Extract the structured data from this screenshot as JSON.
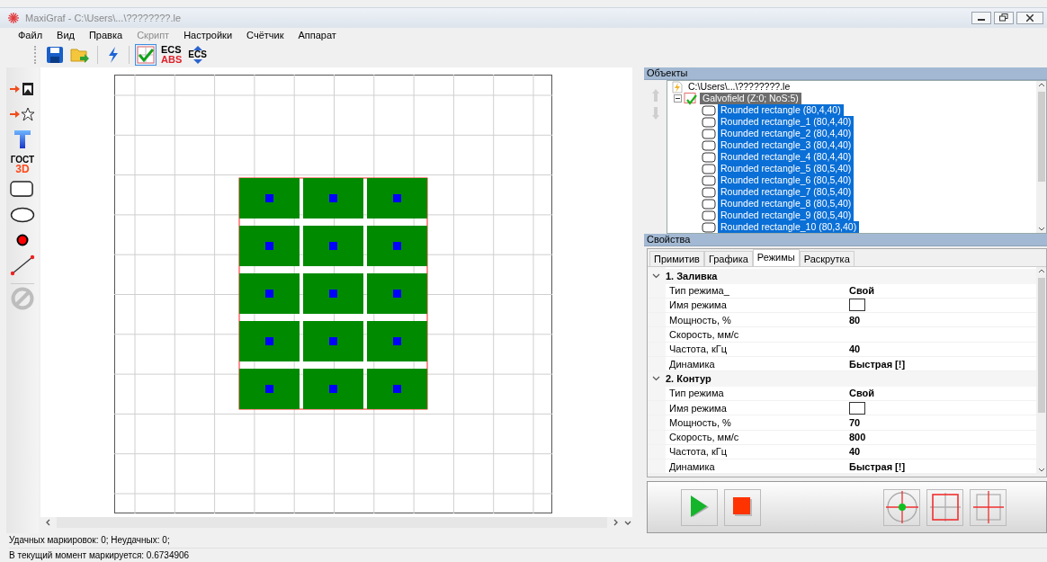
{
  "window": {
    "title": "MaxiGraf - C:\\Users\\...\\????????.le"
  },
  "menu": [
    {
      "label": "Файл",
      "disabled": false
    },
    {
      "label": "Вид",
      "disabled": false
    },
    {
      "label": "Правка",
      "disabled": false
    },
    {
      "label": "Скрипт",
      "disabled": true
    },
    {
      "label": "Настройки",
      "disabled": false
    },
    {
      "label": "Счётчик",
      "disabled": false
    },
    {
      "label": "Аппарат",
      "disabled": false
    }
  ],
  "toolbar": [
    {
      "kind": "save",
      "selected": false
    },
    {
      "kind": "open",
      "selected": false
    },
    {
      "kind": "flash",
      "selected": false
    },
    {
      "kind": "check-grid",
      "selected": true
    },
    {
      "kind": "ecs-abs",
      "selected": false,
      "texts": [
        "ECS",
        "ABS"
      ]
    },
    {
      "kind": "ecs-arrows",
      "selected": false,
      "texts": [
        "ECS"
      ]
    }
  ],
  "toolbox": [
    {
      "kind": "place-image"
    },
    {
      "kind": "place-star"
    },
    {
      "kind": "text-tool"
    },
    {
      "kind": "gost",
      "texts": [
        "ГОСТ",
        "3D"
      ]
    },
    {
      "kind": "rounded-rect"
    },
    {
      "kind": "ellipse"
    },
    {
      "kind": "point"
    },
    {
      "kind": "line"
    },
    {
      "kind": "forbid"
    }
  ],
  "objects": {
    "title": "Объекты",
    "tree": [
      {
        "kind": "file",
        "label": "C:\\Users\\...\\????????.le",
        "children": [
          {
            "kind": "group",
            "label": "Galvofield (Z:0; NoS:5)",
            "selected": true,
            "expanded": true,
            "children": [
              {
                "kind": "shape",
                "label": "Rounded rectangle (80,4,40)",
                "selected": true
              },
              {
                "kind": "shape",
                "label": "Rounded rectangle_1 (80,4,40)",
                "selected": true
              },
              {
                "kind": "shape",
                "label": "Rounded rectangle_2 (80,4,40)",
                "selected": true
              },
              {
                "kind": "shape",
                "label": "Rounded rectangle_3 (80,4,40)",
                "selected": true
              },
              {
                "kind": "shape",
                "label": "Rounded rectangle_4 (80,4,40)",
                "selected": true
              },
              {
                "kind": "shape",
                "label": "Rounded rectangle_5 (80,5,40)",
                "selected": true
              },
              {
                "kind": "shape",
                "label": "Rounded rectangle_6 (80,5,40)",
                "selected": true
              },
              {
                "kind": "shape",
                "label": "Rounded rectangle_7 (80,5,40)",
                "selected": true
              },
              {
                "kind": "shape",
                "label": "Rounded rectangle_8 (80,5,40)",
                "selected": true
              },
              {
                "kind": "shape",
                "label": "Rounded rectangle_9 (80,5,40)",
                "selected": true
              },
              {
                "kind": "shape",
                "label": "Rounded rectangle_10 (80,3,40)",
                "selected": true
              }
            ]
          }
        ]
      }
    ]
  },
  "properties": {
    "title": "Свойства",
    "tabs": [
      {
        "label": "Примитив",
        "selected": false
      },
      {
        "label": "Графика",
        "selected": false
      },
      {
        "label": "Режимы",
        "selected": true
      },
      {
        "label": "Раскрутка",
        "selected": false
      }
    ],
    "groups": [
      {
        "title": "1. Заливка",
        "expanded": true,
        "rows": [
          {
            "kind": "text",
            "label": "Тип режима_",
            "value": "Свой"
          },
          {
            "kind": "swatch",
            "label": "Имя режима"
          },
          {
            "kind": "text",
            "label": "Мощность, %",
            "value": "80"
          },
          {
            "kind": "text",
            "label": "Скорость, мм/с"
          },
          {
            "kind": "text",
            "label": "Частота, кГц",
            "value": "40"
          },
          {
            "kind": "text",
            "label": "Динамика",
            "value": "Быстрая [!]"
          }
        ]
      },
      {
        "title": "2. Контур",
        "expanded": true,
        "rows": [
          {
            "kind": "text",
            "label": "Тип режима",
            "value": "Свой"
          },
          {
            "kind": "swatch",
            "label": "Имя режима"
          },
          {
            "kind": "text",
            "label": "Мощность, %",
            "value": "70"
          },
          {
            "kind": "text",
            "label": "Скорость, мм/с",
            "value": "800"
          },
          {
            "kind": "text",
            "label": "Частота, кГц",
            "value": "40"
          },
          {
            "kind": "text",
            "label": "Динамика",
            "value": "Быстрая [!]"
          }
        ]
      }
    ]
  },
  "controls": [
    {
      "kind": "play"
    },
    {
      "kind": "stop"
    },
    {
      "kind": "target"
    },
    {
      "kind": "frame"
    },
    {
      "kind": "cross"
    }
  ],
  "status": [
    "Удачных маркировок: 0; Неудачных: 0;",
    "В текущий момент маркируется: 0.6734906"
  ]
}
